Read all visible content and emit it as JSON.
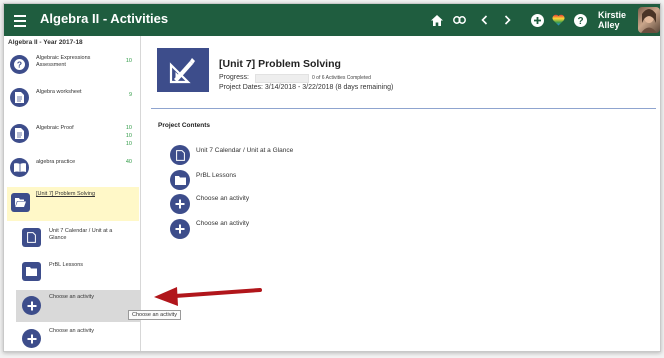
{
  "app": {
    "title": "Algebra II - Activities",
    "user_name_line1": "Kirstie",
    "user_name_line2": "Alley"
  },
  "header_icons": [
    "home-icon",
    "link-icon",
    "chevron-left-icon",
    "chevron-right-icon",
    "add-circle-icon",
    "heart-icon",
    "help-icon"
  ],
  "sidebar": {
    "year": "Algebra II - Year 2017-18",
    "items": [
      {
        "label": "Algebraic Expressions Assessment",
        "scores": [
          "10"
        ],
        "icon": "question-icon"
      },
      {
        "label": "Algebra worksheet",
        "scores": [
          "9"
        ],
        "icon": "document-icon"
      },
      {
        "label": "Algebraic Proof",
        "scores": [
          "10",
          "10",
          "10"
        ],
        "icon": "document-icon"
      },
      {
        "label": "algebra practice",
        "scores": [
          "40"
        ],
        "icon": "book-icon"
      },
      {
        "label": "[Unit 7] Problem Solving",
        "scores": [],
        "icon": "folder-open-icon"
      },
      {
        "label": "Unit 7 Calendar / Unit at a Glance",
        "scores": [],
        "icon": "file-icon"
      },
      {
        "label": "PrBL Lessons",
        "scores": [],
        "icon": "folder-icon"
      },
      {
        "label": "Choose an activity",
        "scores": [],
        "icon": "add-icon"
      },
      {
        "label": "Choose an activity",
        "scores": [],
        "icon": "add-icon"
      }
    ]
  },
  "main": {
    "unit_title": "[Unit 7] Problem Solving",
    "progress_label": "Progress:",
    "progress_fraction": 0,
    "progress_text": "0 of 6 Activities Completed",
    "dates": "Project Dates: 3/14/2018 - 3/22/2018 (8 days remaining)",
    "contents_title": "Project Contents",
    "contents": [
      {
        "label": "Unit 7 Calendar / Unit at a Glance",
        "icon": "file-icon"
      },
      {
        "label": "PrBL Lessons",
        "icon": "folder-icon"
      },
      {
        "label": "Choose an activity",
        "icon": "add-icon"
      },
      {
        "label": "Choose an activity",
        "icon": "add-icon"
      }
    ]
  },
  "tooltip": "Choose an activity",
  "colors": {
    "header": "#1f5d3f",
    "accent": "#3d4d8b",
    "highlight": "#fff8c8",
    "hover": "#d9d9d9",
    "score": "#2f9a45",
    "arrow": "#b1161b"
  }
}
